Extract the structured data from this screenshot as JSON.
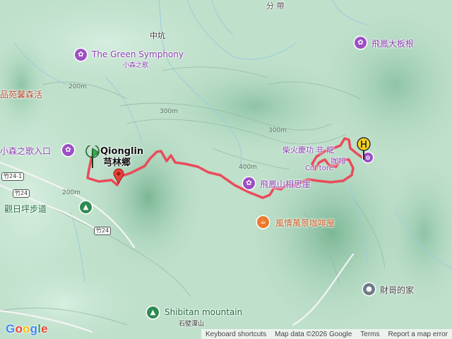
{
  "map": {
    "labels": {
      "zhongkeng": "中坑",
      "green_symphony": "The Green Symphony",
      "green_symphony_sub": "小森之歌",
      "pinyuan": "品苑馨森活",
      "xiaosen_entrance": "小森之歌入口",
      "qionglin_en": "Qionglin",
      "qionglin_zh": "芎林鄉",
      "guanri": "觀日坪步道",
      "feifeng_mountain": "飛鳳大板根",
      "feifeng_xiangsi": "飛鳳山相思崖",
      "fengqing_cafe": "風情萬景咖啡屋",
      "cafe_cluster_a": "柴火慶功 非 龍",
      "cafe_cluster_b": "Cof tore",
      "cafe_cluster_c": "咖啡",
      "caige_home": "財哥的家",
      "shibitan_en": "Shibitan mountain",
      "shibitan_zh": "石壁潭山",
      "top_partial": "分 帶"
    },
    "contours": {
      "c200a": "200m",
      "c200b": "200m",
      "c300a": "300m",
      "c300b": "300m",
      "c400": "400m"
    },
    "roads": {
      "r1": "竹24-1",
      "r2": "竹24",
      "r3": "竹24"
    },
    "icons": {
      "attraction": "attraction-icon",
      "cafe": "cafe-icon",
      "hiking": "hiking-icon",
      "place": "place-pin-icon",
      "start": "start-flag-icon",
      "end": "end-marker-icon"
    },
    "colors": {
      "route": "#ea4b5a",
      "terrain": "#b7dcc6",
      "poi_purple": "#9c4fc4",
      "cafe_orange": "#ec7a2b"
    }
  },
  "footer": {
    "logo": "Google",
    "shortcuts": "Keyboard shortcuts",
    "map_data": "Map data ©2026 Google",
    "terms": "Terms",
    "report": "Report a map error"
  }
}
